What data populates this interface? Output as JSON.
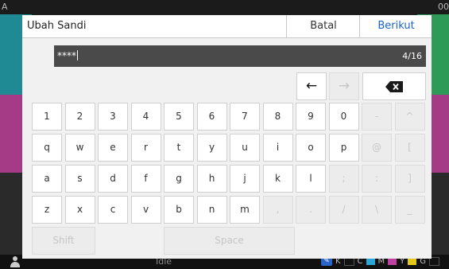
{
  "background": {
    "top_left_char": "A",
    "top_right_chars": "00",
    "status_text": "Idle",
    "toner": [
      "K",
      "C",
      "M",
      "Y",
      "G"
    ],
    "colors": {
      "cyan": "#2aa6d8",
      "magenta": "#c040a0",
      "yellow": "#e4c817",
      "accent": "#1a63c8"
    }
  },
  "dialog": {
    "title": "Ubah Sandi",
    "cancel_label": "Batal",
    "next_label": "Berikut"
  },
  "password_field": {
    "value": "****",
    "count": "4/16"
  },
  "keyboard": {
    "nav": {
      "left_arrow": "←",
      "right_arrow": "→",
      "backspace_icon": "backspace-icon"
    },
    "row1": [
      "1",
      "2",
      "3",
      "4",
      "5",
      "6",
      "7",
      "8",
      "9",
      "0",
      "-",
      "^"
    ],
    "row2": [
      "q",
      "w",
      "e",
      "r",
      "t",
      "y",
      "u",
      "i",
      "o",
      "p",
      "@",
      "["
    ],
    "row3": [
      "a",
      "s",
      "d",
      "f",
      "g",
      "h",
      "j",
      "k",
      "l",
      ";",
      ":",
      "]"
    ],
    "row4": [
      "z",
      "x",
      "c",
      "v",
      "b",
      "n",
      "m",
      ",",
      ".",
      "/",
      "\\",
      "_"
    ],
    "shift_label": "Shift",
    "space_label": "Space"
  }
}
